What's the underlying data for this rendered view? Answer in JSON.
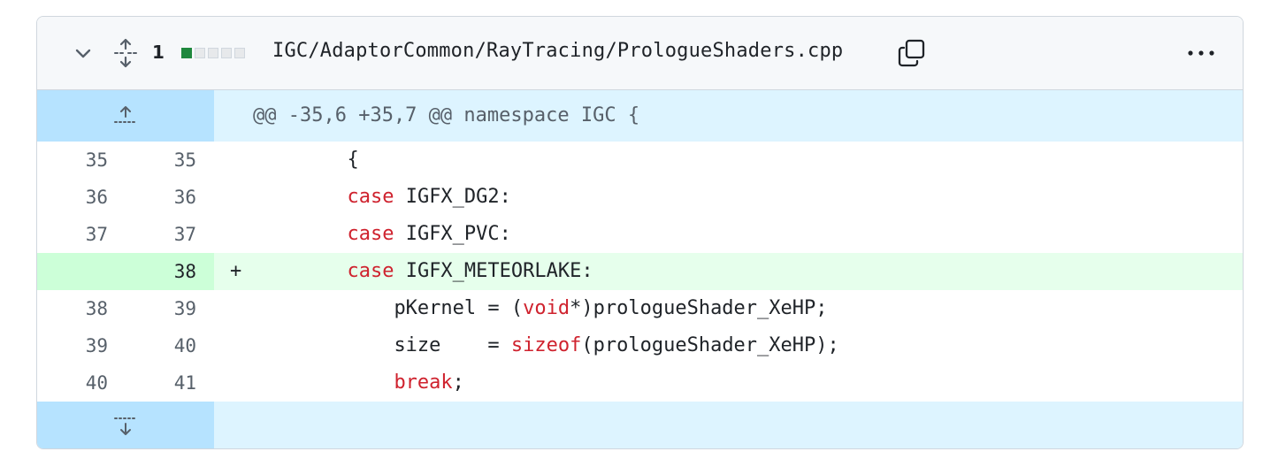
{
  "file": {
    "changes": "1",
    "path": "IGC/AdaptorCommon/RayTracing/PrologueShaders.cpp",
    "diffstat": [
      "add",
      "neutral",
      "neutral",
      "neutral",
      "neutral"
    ],
    "icons": {
      "collapse": "chevron-down-icon",
      "expand": "unfold-icon",
      "copy": "copy-icon",
      "more": "kebab-horizontal-icon",
      "expand_up": "expand-up-icon",
      "expand_down": "expand-down-icon"
    }
  },
  "hunk": {
    "header": "@@ -35,6 +35,7 @@ namespace IGC {"
  },
  "lines": [
    {
      "old": "35",
      "new": "35",
      "marker": "",
      "indent": "      ",
      "tokens": [
        {
          "t": "{",
          "k": false
        }
      ],
      "type": "context"
    },
    {
      "old": "36",
      "new": "36",
      "marker": "",
      "indent": "      ",
      "tokens": [
        {
          "t": "case",
          "k": true
        },
        {
          "t": " IGFX_DG2:",
          "k": false
        }
      ],
      "type": "context"
    },
    {
      "old": "37",
      "new": "37",
      "marker": "",
      "indent": "      ",
      "tokens": [
        {
          "t": "case",
          "k": true
        },
        {
          "t": " IGFX_PVC:",
          "k": false
        }
      ],
      "type": "context"
    },
    {
      "old": "",
      "new": "38",
      "marker": "+",
      "indent": "      ",
      "tokens": [
        {
          "t": "case",
          "k": true
        },
        {
          "t": " IGFX_METEORLAKE:",
          "k": false
        }
      ],
      "type": "add"
    },
    {
      "old": "38",
      "new": "39",
      "marker": "",
      "indent": "          ",
      "tokens": [
        {
          "t": "pKernel = (",
          "k": false
        },
        {
          "t": "void",
          "k": true
        },
        {
          "t": "*)prologueShader_XeHP;",
          "k": false
        }
      ],
      "type": "context"
    },
    {
      "old": "39",
      "new": "40",
      "marker": "",
      "indent": "          ",
      "tokens": [
        {
          "t": "size    = ",
          "k": false
        },
        {
          "t": "sizeof",
          "k": true
        },
        {
          "t": "(prologueShader_XeHP);",
          "k": false
        }
      ],
      "type": "context"
    },
    {
      "old": "40",
      "new": "41",
      "marker": "",
      "indent": "          ",
      "tokens": [
        {
          "t": "break",
          "k": true
        },
        {
          "t": ";",
          "k": false
        }
      ],
      "type": "context"
    }
  ],
  "colors": {
    "add_bg": "#e6ffec",
    "add_gutter": "#ccffd8",
    "hunk_bg": "#ddf4ff",
    "hunk_gutter": "#b6e3ff",
    "keyword": "#cf222e",
    "diffstat_add": "#1f883d"
  }
}
